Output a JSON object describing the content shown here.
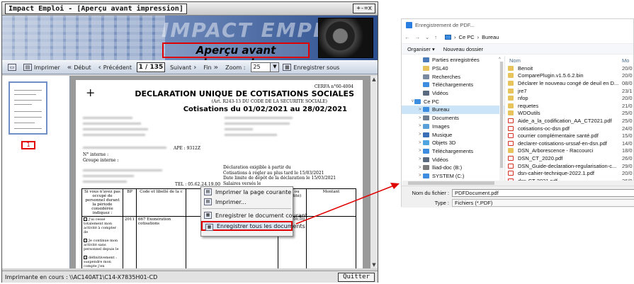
{
  "impact": {
    "title": "Impact Emploi - [Aperçu avant impression]",
    "window_buttons": "+-=x",
    "banner_logo": "IMPACT EMPLOI",
    "banner_heading": "Aperçu avant impression",
    "toolbar": {
      "print": "Imprimer",
      "first": "Début",
      "previous": "Précédent",
      "page_counter": "1 / 135",
      "next": "Suivant",
      "last": "Fin",
      "zoom_label": "Zoom :",
      "zoom_value": "25",
      "save_as": "Enregistrer sous"
    },
    "thumbnail_label": "1",
    "status": "Imprimante en cours : \\\\AC140AT1\\C14-X7835H01-CD",
    "quit": "Quitter"
  },
  "document": {
    "cerfa": "CERFA n°60-4004",
    "title": "DECLARATION UNIQUE DE COTISATIONS SOCIALES",
    "subtitle": "(Art. R243-13 DU CODE DE LA SECURITE SOCIALE)",
    "period": "Cotisations du 01/02/2021 au 28/02/2021",
    "ape": "APE : 9312Z",
    "internal_no": "N° interne :",
    "internal_group": "Groupe interne :",
    "due_lines": [
      "Déclaration exigible à partir du",
      "Cotisations à régler au plus tard le 15/03/2021",
      "Date limite de dépôt de la déclaration le 15/03/2021",
      "Salaires versés le"
    ],
    "tel": "TEL : 05.62.24.19.00",
    "table_headers": [
      "Si vous n'avez pas occupé de personnel durant la période considérée indiquez :",
      "BP",
      "Code et libellé de la c",
      "",
      "ssés ou quantité)",
      "Montant"
    ],
    "row_bp": "2011",
    "row_code": "667 Exonération cotisations",
    "row_amount": "300,00",
    "checkboxes": [
      "J'ai cessé totalement mon activité à compter de",
      "Je continue mon activité sans personnel depuis le",
      "définitivement : suspendre mon compte j'en demanderai la réouverture le cas échéant"
    ]
  },
  "context_menu": {
    "items": [
      "Imprimer la page courante",
      "Imprimer...",
      "Enregistrer le document courant",
      "Enregistrer tous les documents"
    ]
  },
  "save_dialog": {
    "title": "Enregistrement de PDF...",
    "path": [
      "Ce PC",
      "Bureau"
    ],
    "organize": "Organiser ▾",
    "new_folder": "Nouveau dossier",
    "tree": [
      {
        "label": "Parties enregistrées",
        "icon": "#4a7ab8"
      },
      {
        "label": "PSL40",
        "icon": "#e8c25a"
      },
      {
        "label": "Recherches",
        "icon": "#7a8aa0"
      },
      {
        "label": "Téléchargements",
        "icon": "#3c8de0"
      },
      {
        "label": "Vidéos",
        "icon": "#5a6b80"
      },
      {
        "label": "Ce PC",
        "icon": "#3c8de0"
      },
      {
        "label": "Bureau",
        "icon": "#3c8de0"
      },
      {
        "label": "Documents",
        "icon": "#6c7d92"
      },
      {
        "label": "Images",
        "icon": "#5aa0d8"
      },
      {
        "label": "Musique",
        "icon": "#3b6fb6"
      },
      {
        "label": "Objets 3D",
        "icon": "#4fa5e0"
      },
      {
        "label": "Téléchargements",
        "icon": "#3c8de0"
      },
      {
        "label": "Vidéos",
        "icon": "#5a6b80"
      },
      {
        "label": "lliad-doc (B:)",
        "icon": "#7a7a7a"
      },
      {
        "label": "SYSTEM (C:)",
        "icon": "#3c8de0"
      }
    ],
    "col_name": "Nom",
    "col_date": "Mo",
    "files": [
      {
        "name": "Benoit",
        "date": "20/0",
        "icon": "#e8c25a"
      },
      {
        "name": "ComparePlugin.v1.5.6.2.bin",
        "date": "20/0",
        "icon": "#e8c25a"
      },
      {
        "name": "Déclarer le nouveau congé de deuil en D...",
        "date": "08/0",
        "icon": "#e8c25a"
      },
      {
        "name": "jre7",
        "date": "23/1",
        "icon": "#e8c25a"
      },
      {
        "name": "nfop",
        "date": "20/0",
        "icon": "#e8c25a"
      },
      {
        "name": "requetes",
        "date": "21/0",
        "icon": "#e8c25a"
      },
      {
        "name": "WDOutils",
        "date": "25/0",
        "icon": "#e8c25a"
      },
      {
        "name": "Aide_a_la_codification_AA_CT2021.pdf",
        "date": "25/0",
        "icon": "#d93025"
      },
      {
        "name": "cotisations-oc-dsn.pdf",
        "date": "24/0",
        "icon": "#d93025"
      },
      {
        "name": "courrier complémentaire santé.pdf",
        "date": "15/0",
        "icon": "#d93025"
      },
      {
        "name": "declarer-cotisations-urssaf-en-dsn.pdf",
        "date": "14/0",
        "icon": "#d93025"
      },
      {
        "name": "DSN_Arborescence - Raccourci",
        "date": "18/0",
        "icon": "#e8c25a"
      },
      {
        "name": "DSN_CT_2020.pdf",
        "date": "26/0",
        "icon": "#d93025"
      },
      {
        "name": "DSN_Guide-declaration-regularisation-c...",
        "date": "29/0",
        "icon": "#d93025"
      },
      {
        "name": "dsn-cahier-technique-2022.1.pdf",
        "date": "20/0",
        "icon": "#d93025"
      },
      {
        "name": "dsn-CT-2021.pdf",
        "date": "26/0",
        "icon": "#d93025"
      }
    ],
    "filename_label": "Nom du fichier :",
    "filename_value": "PDFDocument.pdf",
    "type_label": "Type :",
    "type_value": "Fichiers (*.PDF)"
  },
  "colors": {
    "highlight": "#e00000",
    "arrow": "#e00000"
  }
}
